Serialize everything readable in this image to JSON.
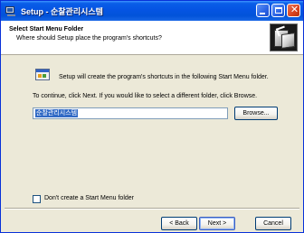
{
  "window": {
    "title": "Setup - 순찰관리시스템"
  },
  "header": {
    "title": "Select Start Menu Folder",
    "subtitle": "Where should Setup place the program's shortcuts?"
  },
  "body": {
    "info": "Setup will create the program's shortcuts in the following Start Menu folder.",
    "instruction": "To continue, click Next. If you would like to select a different folder, click Browse.",
    "folder_value": "순찰관리시스템",
    "browse_label": "Browse...",
    "no_folder_checkbox_label": "Don't create a Start Menu folder",
    "no_folder_checked": false
  },
  "footer": {
    "back_label": "< Back",
    "next_label": "Next >",
    "cancel_label": "Cancel"
  },
  "colors": {
    "titlebar": "#0554e3",
    "dialog_bg": "#ece9d8",
    "selection": "#316ac5"
  },
  "icons": {
    "app": "setup-computer-icon",
    "header": "install-box-icon",
    "folder": "program-group-icon"
  }
}
